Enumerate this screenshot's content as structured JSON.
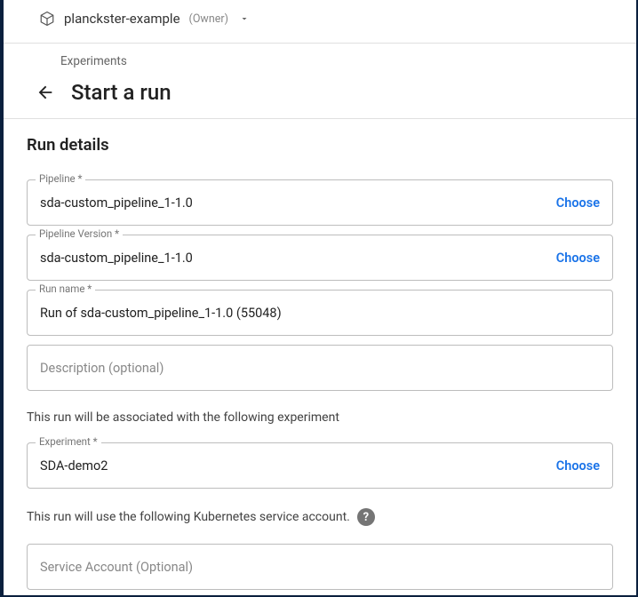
{
  "header": {
    "project_name": "planckster-example",
    "owner_tag": "(Owner)"
  },
  "breadcrumb": "Experiments",
  "page_title": "Start a run",
  "section_title": "Run details",
  "fields": {
    "pipeline": {
      "label": "Pipeline *",
      "value": "sda-custom_pipeline_1-1.0",
      "choose": "Choose"
    },
    "pipeline_version": {
      "label": "Pipeline Version *",
      "value": "sda-custom_pipeline_1-1.0",
      "choose": "Choose"
    },
    "run_name": {
      "label": "Run name *",
      "value": "Run of sda-custom_pipeline_1-1.0 (55048)"
    },
    "description": {
      "placeholder": "Description (optional)"
    },
    "experiment": {
      "label": "Experiment *",
      "value": "SDA-demo2",
      "choose": "Choose"
    },
    "service_account": {
      "placeholder": "Service Account (Optional)"
    }
  },
  "helper": {
    "experiment": "This run will be associated with the following experiment",
    "service_account": "This run will use the following Kubernetes service account."
  }
}
